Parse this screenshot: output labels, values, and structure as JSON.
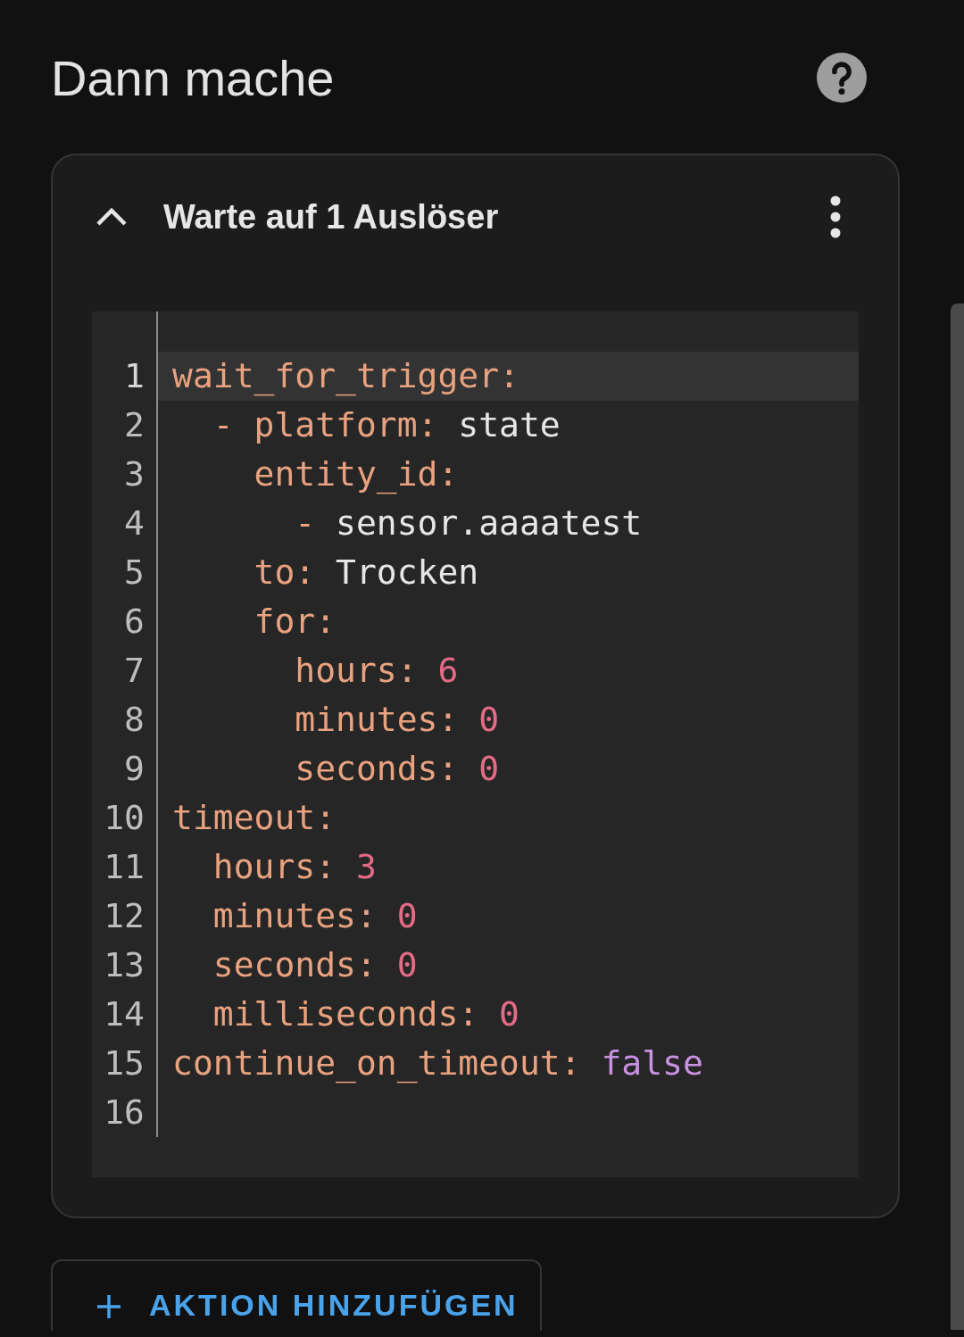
{
  "page_title": "Dann mache",
  "action_card": {
    "title": "Warte auf 1 Auslöser",
    "expanded": true,
    "code_lines": [
      {
        "number": "1",
        "active": true,
        "tokens": [
          {
            "kind": "key",
            "text": "wait_for_trigger:"
          }
        ]
      },
      {
        "number": "2",
        "active": false,
        "tokens": [
          {
            "kind": "key",
            "text": "  - platform:"
          },
          {
            "kind": "string",
            "text": " state"
          }
        ]
      },
      {
        "number": "3",
        "active": false,
        "tokens": [
          {
            "kind": "key",
            "text": "    entity_id:"
          }
        ]
      },
      {
        "number": "4",
        "active": false,
        "tokens": [
          {
            "kind": "key",
            "text": "      -"
          },
          {
            "kind": "string",
            "text": " sensor.aaaatest"
          }
        ]
      },
      {
        "number": "5",
        "active": false,
        "tokens": [
          {
            "kind": "key",
            "text": "    to:"
          },
          {
            "kind": "string",
            "text": " Trocken"
          }
        ]
      },
      {
        "number": "6",
        "active": false,
        "tokens": [
          {
            "kind": "key",
            "text": "    for:"
          }
        ]
      },
      {
        "number": "7",
        "active": false,
        "tokens": [
          {
            "kind": "key",
            "text": "      hours:"
          },
          {
            "kind": "number",
            "text": " 6"
          }
        ]
      },
      {
        "number": "8",
        "active": false,
        "tokens": [
          {
            "kind": "key",
            "text": "      minutes:"
          },
          {
            "kind": "number",
            "text": " 0"
          }
        ]
      },
      {
        "number": "9",
        "active": false,
        "tokens": [
          {
            "kind": "key",
            "text": "      seconds:"
          },
          {
            "kind": "number",
            "text": " 0"
          }
        ]
      },
      {
        "number": "10",
        "active": false,
        "tokens": [
          {
            "kind": "key",
            "text": "timeout:"
          }
        ]
      },
      {
        "number": "11",
        "active": false,
        "tokens": [
          {
            "kind": "key",
            "text": "  hours:"
          },
          {
            "kind": "number",
            "text": " 3"
          }
        ]
      },
      {
        "number": "12",
        "active": false,
        "tokens": [
          {
            "kind": "key",
            "text": "  minutes:"
          },
          {
            "kind": "number",
            "text": " 0"
          }
        ]
      },
      {
        "number": "13",
        "active": false,
        "tokens": [
          {
            "kind": "key",
            "text": "  seconds:"
          },
          {
            "kind": "number",
            "text": " 0"
          }
        ]
      },
      {
        "number": "14",
        "active": false,
        "tokens": [
          {
            "kind": "key",
            "text": "  milliseconds:"
          },
          {
            "kind": "number",
            "text": " 0"
          }
        ]
      },
      {
        "number": "15",
        "active": false,
        "tokens": [
          {
            "kind": "key",
            "text": "continue_on_timeout:"
          },
          {
            "kind": "bool",
            "text": " false"
          }
        ]
      },
      {
        "number": "16",
        "active": false
      }
    ]
  },
  "add_button": {
    "label": "AKTION HINZUFÜGEN"
  }
}
